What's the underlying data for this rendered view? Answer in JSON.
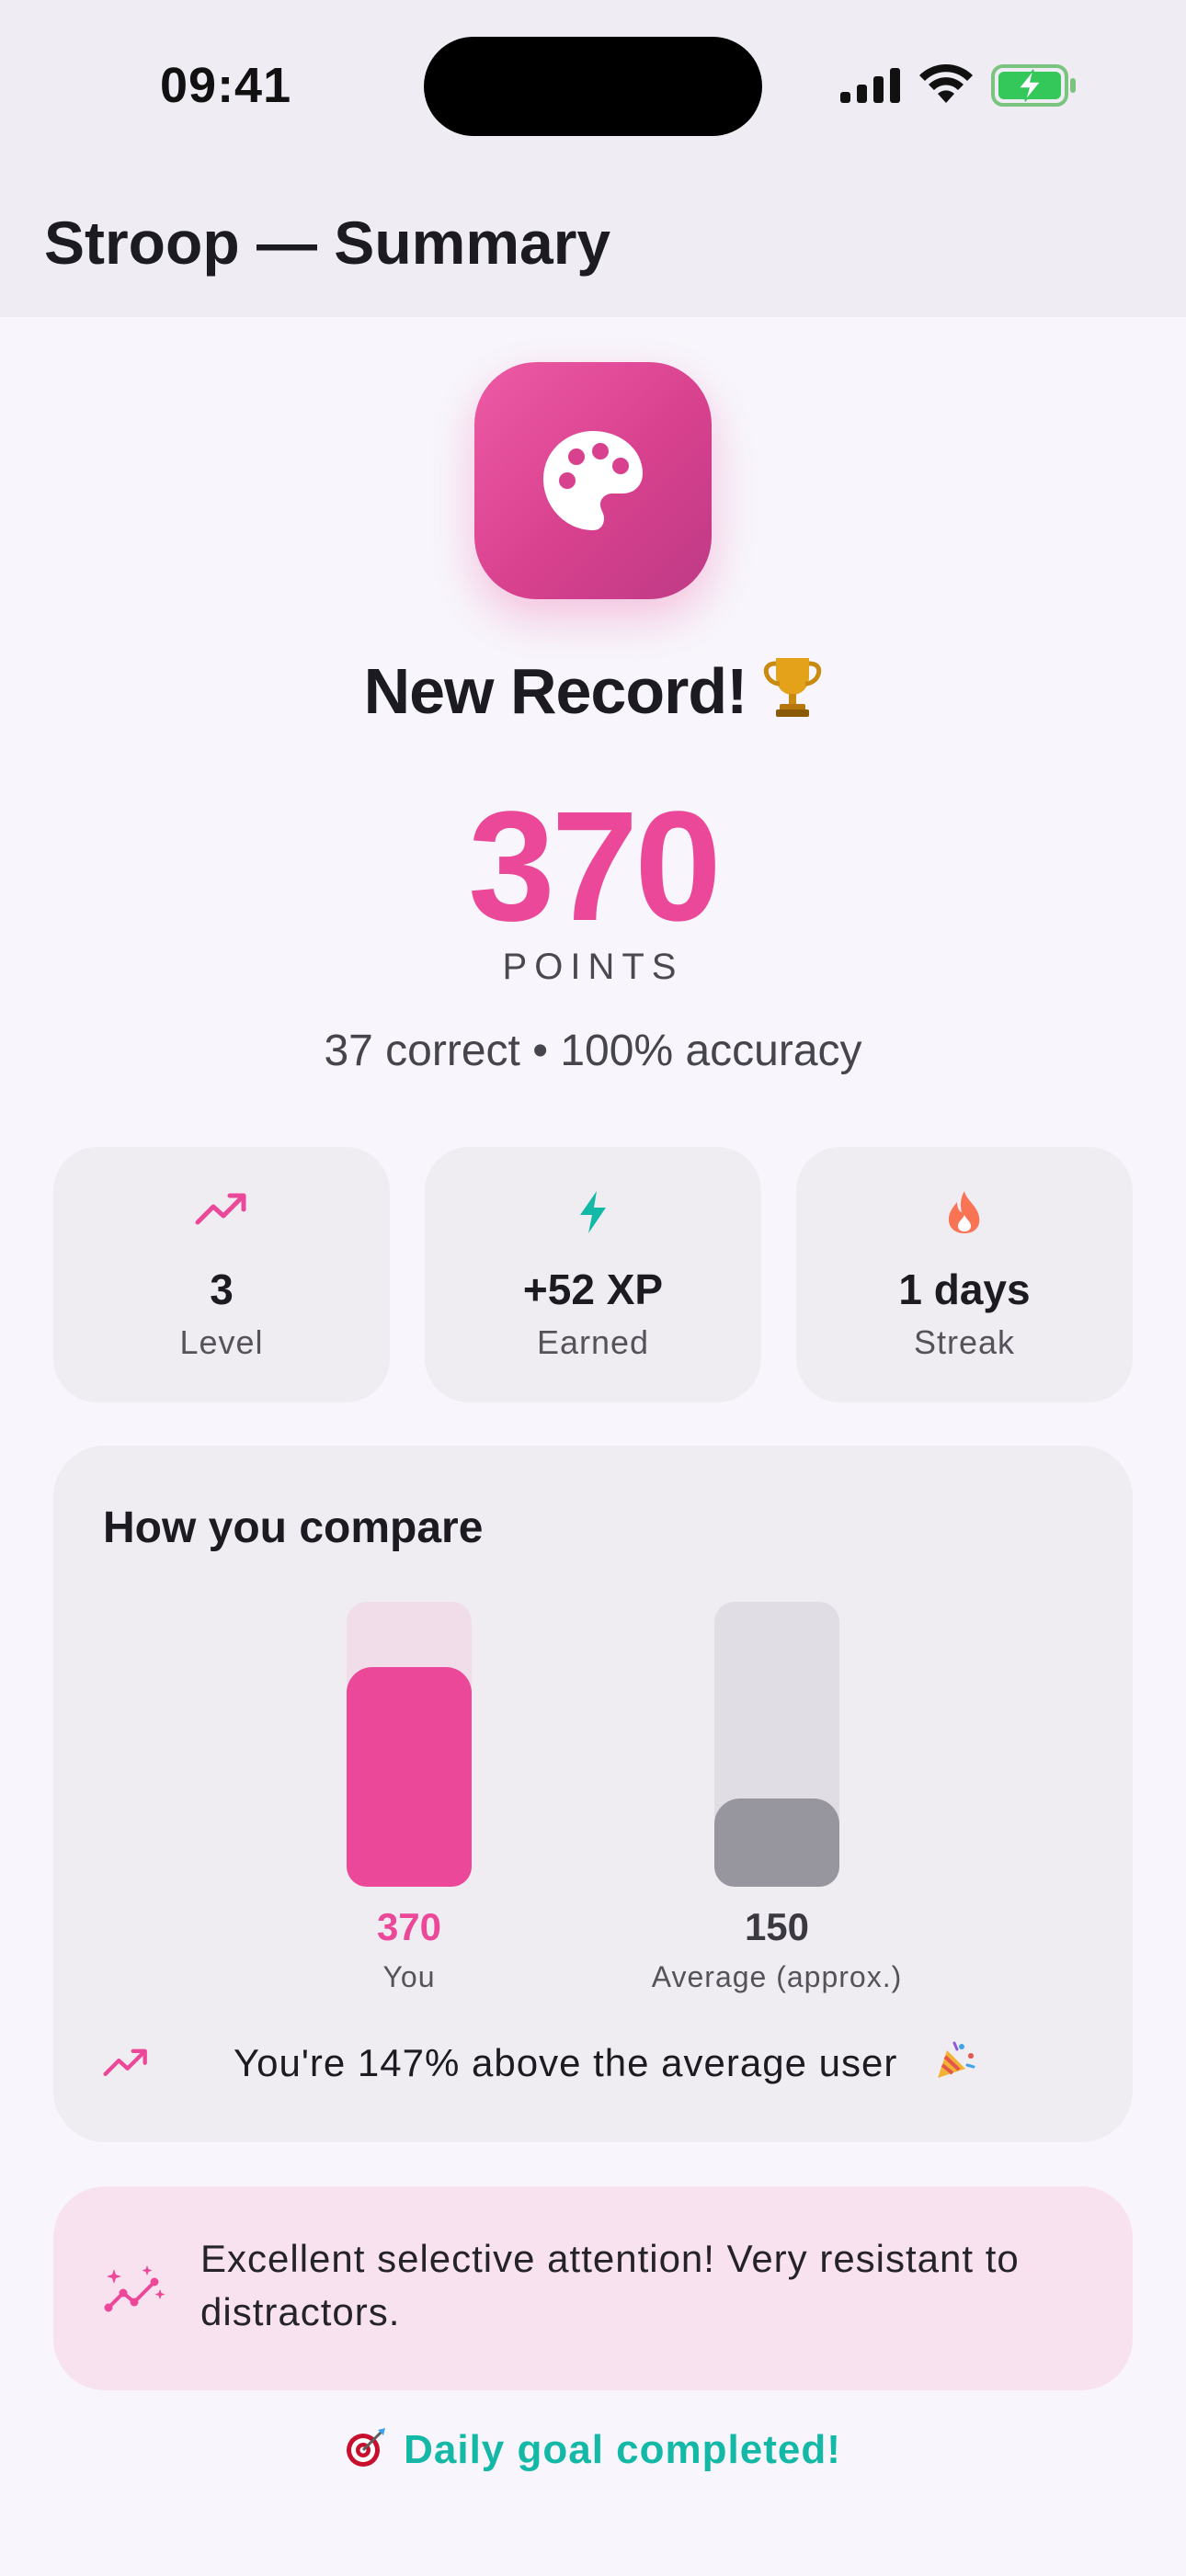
{
  "status_bar": {
    "time": "09:41",
    "icons": [
      "signal-icon",
      "wifi-icon",
      "battery-charging-icon"
    ]
  },
  "nav": {
    "title": "Stroop — Summary"
  },
  "hero": {
    "icon": "palette-icon",
    "headline": "New Record!",
    "headline_emoji": "trophy-icon",
    "score": "370",
    "score_unit": "POINTS",
    "detail": "37 correct • 100% accuracy"
  },
  "stats": [
    {
      "icon": "trending-up-icon",
      "value": "3",
      "label": "Level",
      "color": "#EC4899"
    },
    {
      "icon": "lightning-icon",
      "value": "+52 XP",
      "label": "Earned",
      "color": "#14B8A6"
    },
    {
      "icon": "flame-icon",
      "value": "1 days",
      "label": "Streak",
      "color": "#F97355"
    }
  ],
  "compare": {
    "title": "How you compare",
    "bars": [
      {
        "value": "370",
        "label": "You",
        "fill_fraction": 0.77,
        "color": "#EC4899",
        "track_color": "#F1DCEA"
      },
      {
        "value": "150",
        "label": "Average (approx.)",
        "fill_fraction": 0.31,
        "color": "#97959D",
        "track_color": "#E0DEE4"
      }
    ],
    "note": "You're 147% above the average user",
    "note_icon": "trending-up-icon",
    "note_emoji": "party-popper-icon"
  },
  "insight": {
    "icon": "sparkle-chart-icon",
    "text": "Excellent selective attention! Very resistant to distractors."
  },
  "goal": {
    "icon": "target-icon",
    "text": "Daily goal completed!"
  },
  "colors": {
    "accent": "#EC4899",
    "teal": "#14B8A6",
    "background": "#F8F6FC",
    "card": "#EFEDF2"
  }
}
